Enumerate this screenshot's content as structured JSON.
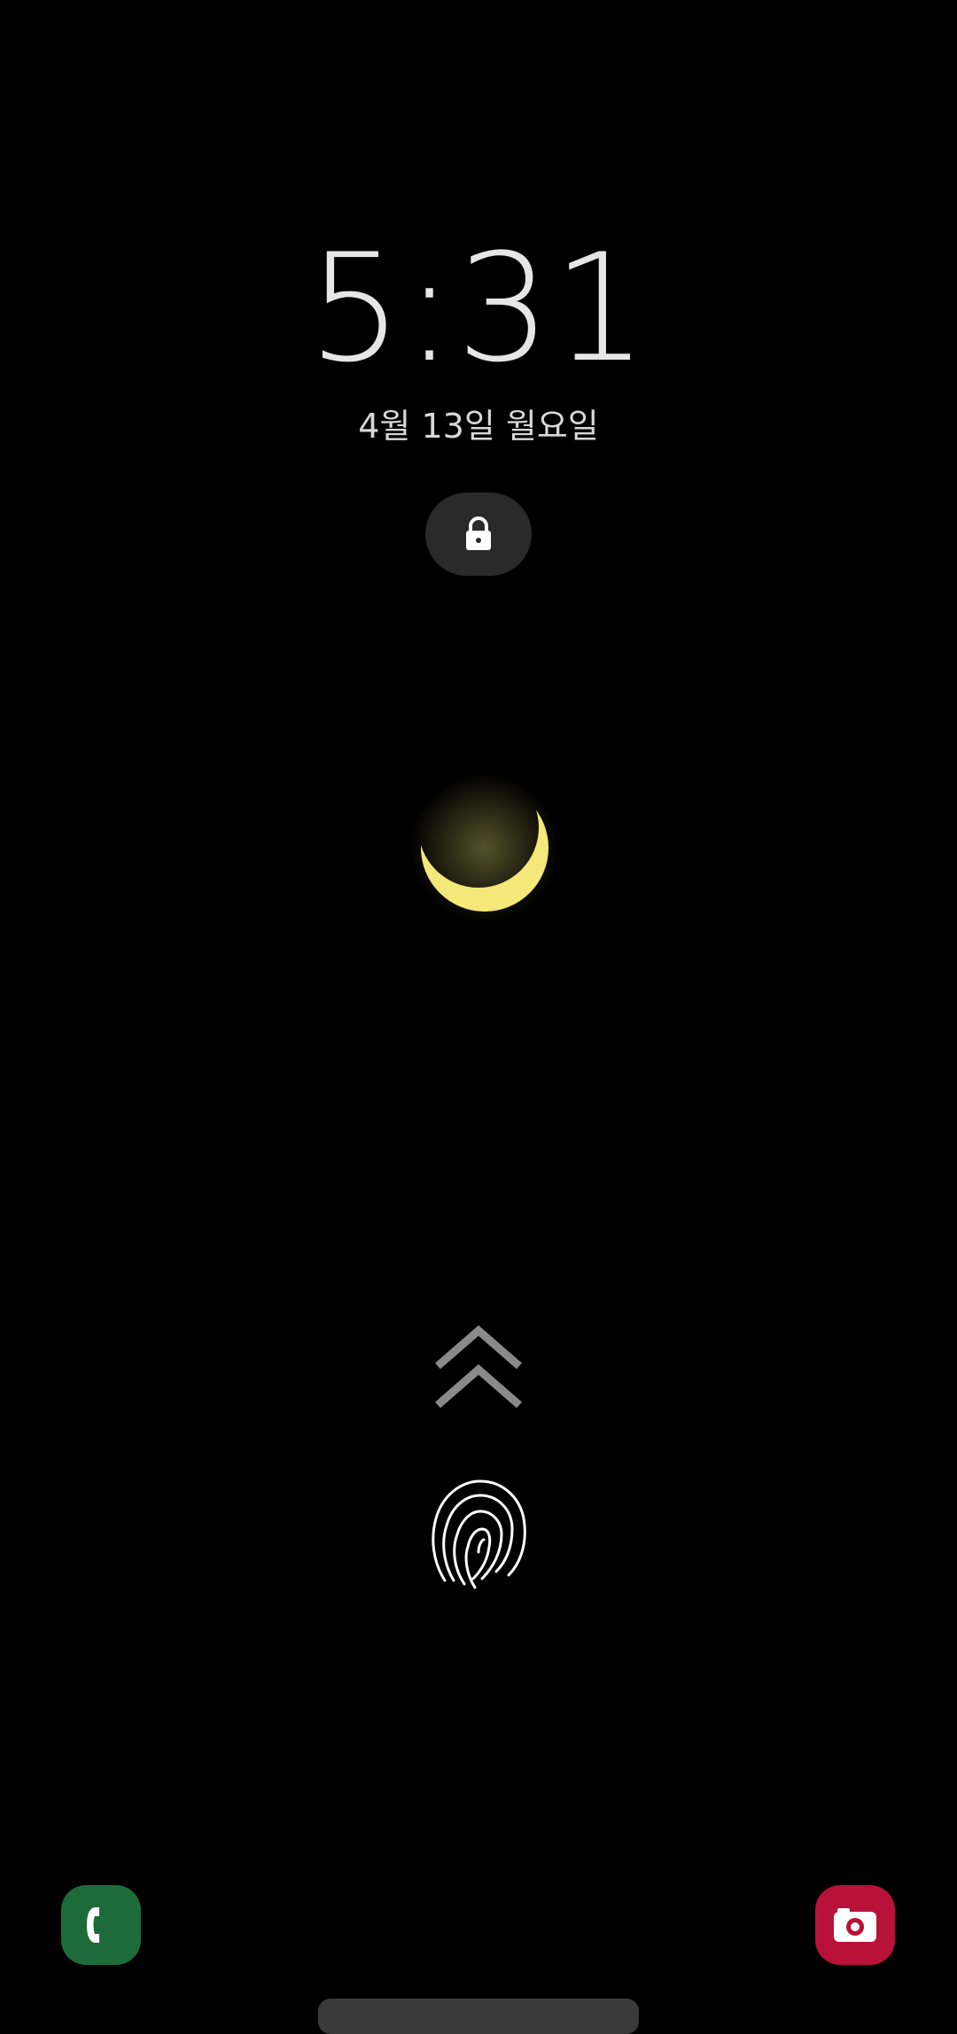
{
  "lockscreen": {
    "time": "5:31",
    "date": "4월 13일 월요일"
  },
  "icons": {
    "lock": "lock-icon",
    "wallpaper": "crescent-moon",
    "swipe": "double-chevron-up-icon",
    "fingerprint": "fingerprint-icon",
    "phone": "phone-icon",
    "camera": "camera-icon"
  },
  "colors": {
    "background": "#000000",
    "moon": "#f4e878",
    "phone_shortcut": "#1d6b3a",
    "camera_shortcut": "#b8123a"
  }
}
